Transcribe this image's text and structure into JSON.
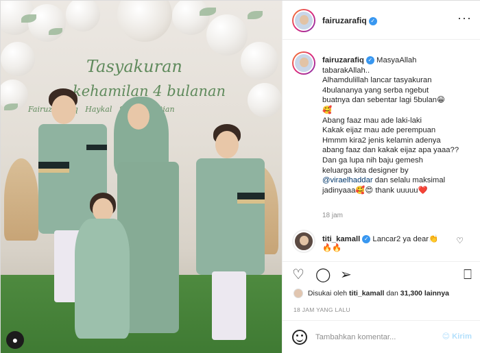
{
  "post": {
    "username": "fairuzarafiq",
    "more_icon": "more-horizontal-icon"
  },
  "photo": {
    "banner_line1": "Tasyakuran",
    "banner_line2": "kehamilan 4 bulanan",
    "banner_line3": "Fairuz Arafiq   Haykal   Sonny Septian"
  },
  "caption": {
    "username": "fairuzarafiq",
    "lines": [
      "MasyaAllah",
      "tabarakAllah..",
      "Alhamdulillah lancar tasyakuran",
      "4bulananya yang serba ngebut",
      "buatnya dan sebentar lagi 5bulan😁",
      "🥰",
      "Abang faaz mau ade laki-laki",
      "Kakak eijaz mau ade perempuan",
      "Hmmm kira2 jenis kelamin adenya",
      "abang faaz dan kakak eijaz apa yaaa??",
      "Dan ga lupa nih baju gemesh",
      "keluarga kita designer by",
      "@viraelhaddar",
      "dan selalu maksimal",
      "jadinyaaa🥰😍 thank uuuuu❤️"
    ],
    "time": "18 jam"
  },
  "comment": {
    "username": "titi_kamall",
    "text": "Lancar2 ya dear👏",
    "text2": "🔥🔥",
    "like_icon": "heart-outline-icon"
  },
  "actions": {
    "like_icon": "heart-icon",
    "comment_icon": "comment-icon",
    "share_icon": "share-icon",
    "save_icon": "bookmark-icon"
  },
  "likes": {
    "prefix": "Disukai oleh",
    "user": "titi_kamall",
    "middle": "dan",
    "count": "31,300 lainnya"
  },
  "post_time": "18 JAM YANG LALU",
  "add_comment": {
    "placeholder": "Tambahkan komentar...",
    "send_label": "Kirim"
  },
  "colors": {
    "verified": "#3897f0",
    "link": "#00376b",
    "send_disabled": "#b2dffc"
  }
}
